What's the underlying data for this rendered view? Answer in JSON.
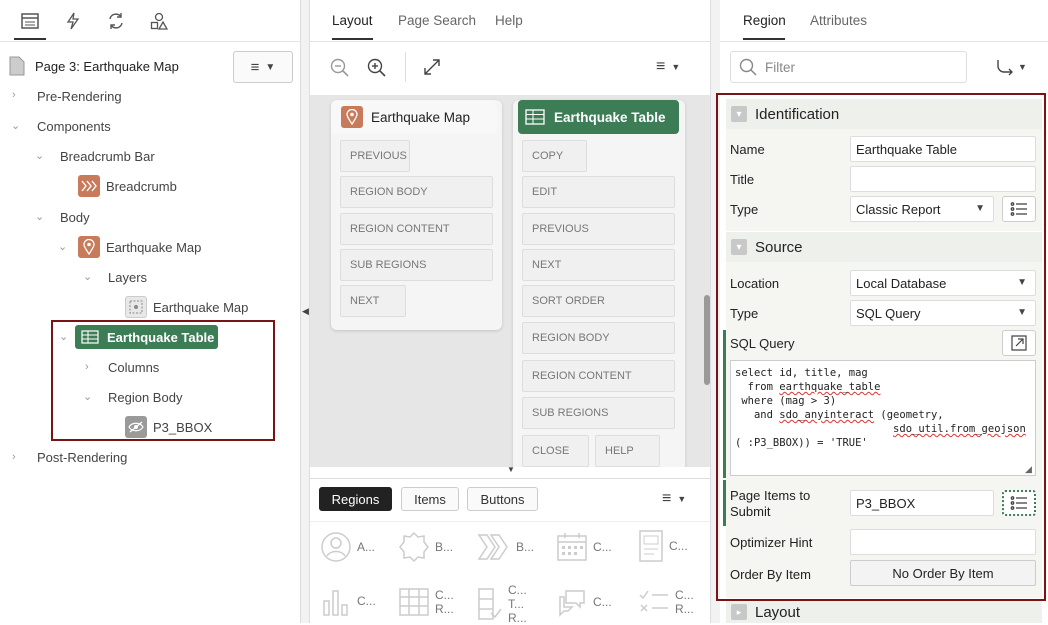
{
  "left_panel": {
    "page_title": "Page 3: Earthquake Map",
    "tree": {
      "pre_rendering": "Pre-Rendering",
      "components": "Components",
      "breadcrumb_bar": "Breadcrumb Bar",
      "breadcrumb": "Breadcrumb",
      "body": "Body",
      "earthquake_map": "Earthquake Map",
      "layers": "Layers",
      "layer_earthquake_map": "Earthquake Map",
      "earthquake_table": "Earthquake Table",
      "columns": "Columns",
      "region_body": "Region Body",
      "p3_bbox": "P3_BBOX",
      "post_rendering": "Post-Rendering"
    }
  },
  "middle_panel": {
    "tabs": [
      "Layout",
      "Page Search",
      "Help"
    ],
    "map_card": {
      "title": "Earthquake Map",
      "slots": [
        "PREVIOUS",
        "REGION BODY",
        "REGION CONTENT",
        "SUB REGIONS",
        "NEXT"
      ]
    },
    "table_card": {
      "title": "Earthquake Table",
      "slots": [
        "COPY",
        "EDIT",
        "PREVIOUS",
        "NEXT",
        "SORT ORDER",
        "REGION BODY",
        "REGION CONTENT",
        "SUB REGIONS",
        "CLOSE",
        "HELP"
      ]
    },
    "gallery": {
      "tabs": [
        "Regions",
        "Items",
        "Buttons"
      ],
      "items": [
        {
          "label": "A..."
        },
        {
          "label": "B..."
        },
        {
          "label": "B..."
        },
        {
          "label": "C..."
        },
        {
          "label": "C..."
        },
        {
          "label": "C..."
        },
        {
          "label": "C...",
          "label2": "R..."
        },
        {
          "label": "C...",
          "label2": "T...",
          "label3": "R..."
        },
        {
          "label": "C..."
        },
        {
          "label": "C...",
          "label2": "R..."
        }
      ]
    }
  },
  "right_panel": {
    "tabs": [
      "Region",
      "Attributes"
    ],
    "filter_placeholder": "Filter",
    "identification": {
      "heading": "Identification",
      "name_label": "Name",
      "name_value": "Earthquake Table",
      "title_label": "Title",
      "title_value": "",
      "type_label": "Type",
      "type_value": "Classic Report"
    },
    "source": {
      "heading": "Source",
      "location_label": "Location",
      "location_value": "Local Database",
      "type_label": "Type",
      "type_value": "SQL Query",
      "sql_label": "SQL Query",
      "sql_lines": [
        "select id, title, mag",
        "  from earthquake_table",
        " where (mag > 3)",
        "   and sdo_anyinteract (geometry,",
        "                         sdo_util.from_geojson",
        "( :P3_BBOX)) = 'TRUE'"
      ],
      "page_items_label_1": "Page Items to",
      "page_items_label_2": "Submit",
      "page_items_value": "P3_BBOX",
      "optimizer_label": "Optimizer Hint",
      "optimizer_value": "",
      "order_by_label": "Order By Item",
      "order_by_value": "No Order By Item"
    },
    "layout_heading": "Layout"
  },
  "colors": {
    "highlight_green": "#3d7d55",
    "red_outline": "#7a1414",
    "map_icon": "#c77b5a",
    "breadcrumb_icon": "#c77b5a"
  }
}
